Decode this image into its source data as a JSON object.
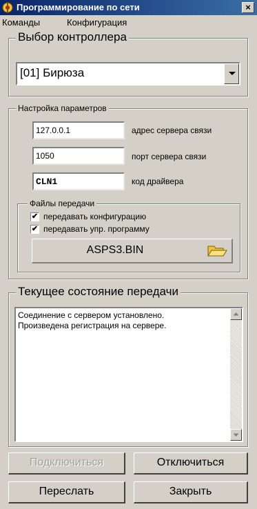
{
  "window": {
    "title": "Программирование по сети",
    "close_label": "×"
  },
  "menu": {
    "items": [
      "Команды",
      "Конфигурация"
    ]
  },
  "controller": {
    "legend": "Выбор контроллера",
    "selected": "[01] Бирюза"
  },
  "params": {
    "legend": "Настройка параметров",
    "server_address": {
      "value": "127.0.0.1",
      "label": "адрес сервера связи"
    },
    "server_port": {
      "value": "1050",
      "label": "порт сервера связи"
    },
    "driver_code": {
      "value": "CLN1",
      "label": "код драйвера"
    }
  },
  "files": {
    "legend": "Файлы передачи",
    "send_config": {
      "label": "передавать конфигурацию",
      "checked": true
    },
    "send_program": {
      "label": "передавать упр. программу",
      "checked": true
    },
    "file_name": "ASPS3.BIN"
  },
  "status": {
    "legend": "Текущее состояние передачи",
    "lines": [
      "Соединение с сервером установлено.",
      "Произведена регистрация на сервере."
    ]
  },
  "buttons": {
    "connect": "Подключиться",
    "disconnect": "Отключиться",
    "send": "Переслать",
    "close": "Закрыть"
  },
  "checkmark": "✔",
  "colors": {
    "titlebar_start": "#0a246a",
    "titlebar_end": "#3a6ea5",
    "face": "#d4d0c8",
    "folder": "#f0c040"
  }
}
